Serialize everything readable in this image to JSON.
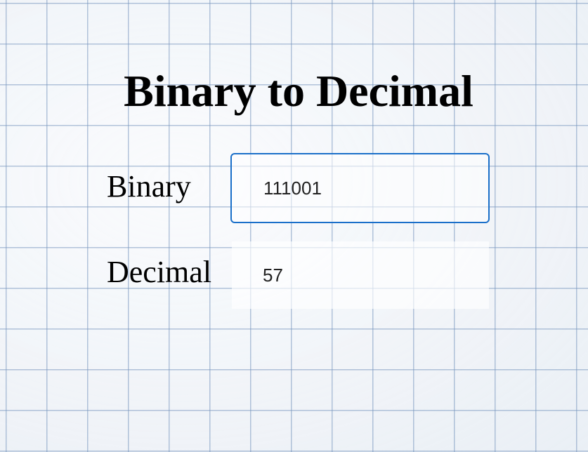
{
  "page": {
    "title": "Binary to Decimal"
  },
  "form": {
    "binary_label": "Binary",
    "binary_value": "111001",
    "decimal_label": "Decimal",
    "decimal_value": "57"
  },
  "colors": {
    "input_focus_border": "#1a6fc9",
    "grid_line": "#7896be"
  }
}
